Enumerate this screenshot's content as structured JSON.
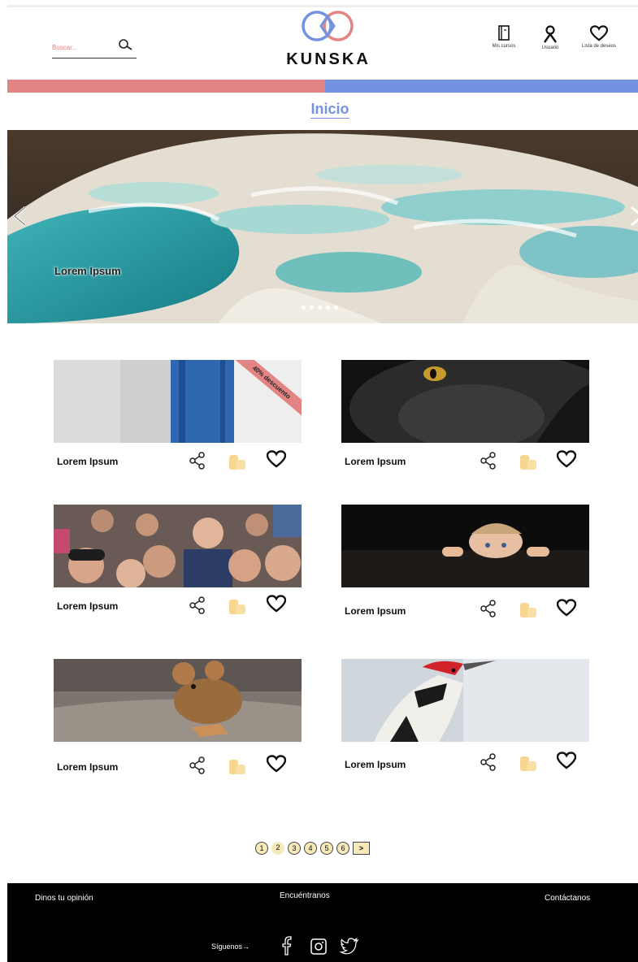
{
  "header": {
    "search_placeholder": "Buscar...",
    "brand": "KUNSKA",
    "nav": [
      {
        "label": "Mis cursos",
        "icon": "book-icon"
      },
      {
        "label": "Usuario",
        "icon": "user-icon"
      },
      {
        "label": "Lista de deseos",
        "icon": "heart-icon"
      }
    ],
    "colors": {
      "red": "#e48383",
      "blue": "#7393e0"
    }
  },
  "page_title": "Inicio",
  "hero": {
    "caption": "Lorem Ipsum",
    "dots": 5
  },
  "cards": [
    {
      "title": "Lorem Ipsum",
      "badge": "40% descuento"
    },
    {
      "title": "Lorem Ipsum"
    },
    {
      "title": "Lorem Ipsum"
    },
    {
      "title": "Lorem Ipsum"
    },
    {
      "title": "Lorem Ipsum"
    },
    {
      "title": "Lorem Ipsum"
    }
  ],
  "pagination": {
    "pages": [
      "1",
      "2",
      "3",
      "4",
      "5",
      "6"
    ],
    "next_label": ">"
  },
  "footer": {
    "opinion": "Dinos tu opinión",
    "find": "Encuéntranos",
    "contact": "Contáctanos",
    "follow": "Síguenos→",
    "social": [
      "facebook-icon",
      "instagram-icon",
      "twitter-icon"
    ]
  }
}
